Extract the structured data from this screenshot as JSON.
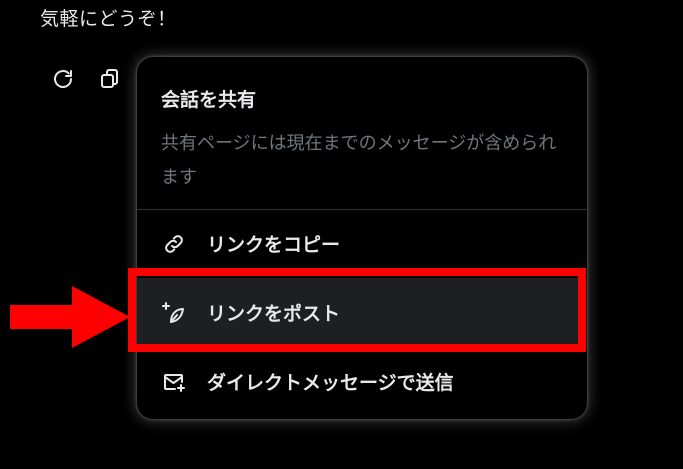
{
  "message": {
    "text": "気軽にどうぞ！"
  },
  "actions": {
    "icons": [
      "refresh-icon",
      "copy-icon"
    ]
  },
  "share_popup": {
    "title": "会話を共有",
    "description": "共有ページには現在までのメッセージが含められます",
    "items": [
      {
        "label": "リンクをコピー",
        "icon": "link-icon"
      },
      {
        "label": "リンクをポスト",
        "icon": "post-sparkle-icon"
      },
      {
        "label": "ダイレクトメッセージで送信",
        "icon": "envelope-plus-icon"
      }
    ]
  },
  "colors": {
    "background": "#000000",
    "text": "#e7e9ea",
    "muted_text": "#71767b",
    "divider": "#2f3336",
    "hover_item": "#1d1f23",
    "annotation_red": "#ff0000"
  }
}
